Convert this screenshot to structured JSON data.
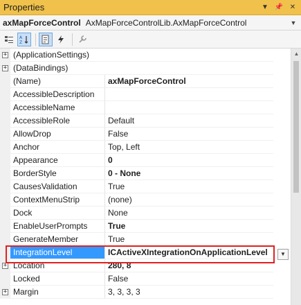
{
  "window": {
    "title": "Properties"
  },
  "object": {
    "name": "axMapForceControl",
    "type": "AxMapForceControlLib.AxMapForceControl"
  },
  "toolbar": {
    "tools": [
      {
        "name": "categorized-icon",
        "glyph": "▦"
      },
      {
        "name": "alphabetical-icon",
        "glyph": "↓z"
      },
      {
        "name": "properties-icon",
        "glyph": "▣"
      },
      {
        "name": "events-icon",
        "glyph": "ϟ"
      },
      {
        "name": "property-pages-icon",
        "glyph": "⚙"
      }
    ]
  },
  "rows": [
    {
      "name": "(ApplicationSettings)",
      "value": "",
      "expandable": true
    },
    {
      "name": "(DataBindings)",
      "value": "",
      "expandable": true
    },
    {
      "name": "(Name)",
      "value": "axMapForceControl",
      "bold": true
    },
    {
      "name": "AccessibleDescription",
      "value": ""
    },
    {
      "name": "AccessibleName",
      "value": ""
    },
    {
      "name": "AccessibleRole",
      "value": "Default"
    },
    {
      "name": "AllowDrop",
      "value": "False"
    },
    {
      "name": "Anchor",
      "value": "Top, Left"
    },
    {
      "name": "Appearance",
      "value": "0",
      "bold": true
    },
    {
      "name": "BorderStyle",
      "value": "0 - None",
      "bold": true
    },
    {
      "name": "CausesValidation",
      "value": "True"
    },
    {
      "name": "ContextMenuStrip",
      "value": "(none)"
    },
    {
      "name": "Dock",
      "value": "None"
    },
    {
      "name": "EnableUserPrompts",
      "value": "True",
      "bold": true
    },
    {
      "name": "GenerateMember",
      "value": "True"
    },
    {
      "name": "IntegrationLevel",
      "value": "ICActiveXIntegrationOnApplicationLevel",
      "bold": true,
      "selected": true
    },
    {
      "name": "Location",
      "value": "280, 8",
      "bold": true,
      "expandable": true
    },
    {
      "name": "Locked",
      "value": "False"
    },
    {
      "name": "Margin",
      "value": "3, 3, 3, 3",
      "expandable": true
    }
  ],
  "colors": {
    "title_bar": "#f0c14b",
    "selection": "#3399ff",
    "highlight_border": "#e02020"
  }
}
